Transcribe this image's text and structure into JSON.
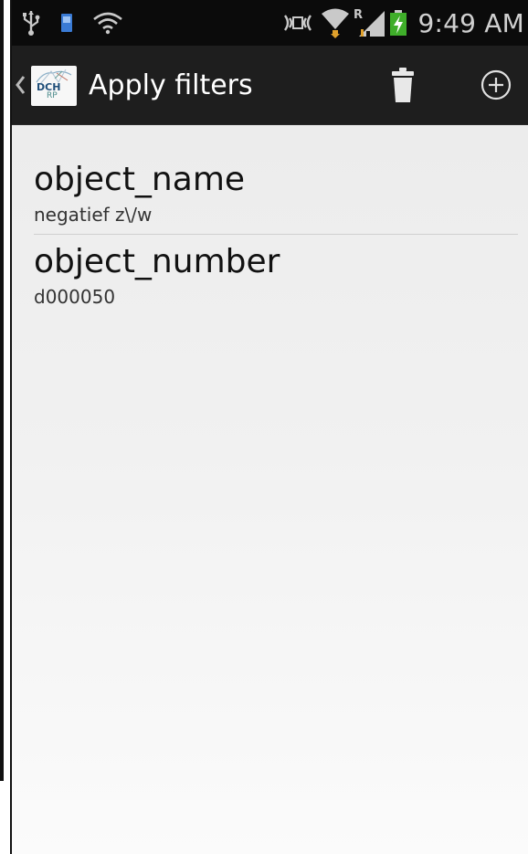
{
  "status_bar": {
    "time": "9:49 AM",
    "icons": [
      "usb-icon",
      "sim-icon",
      "wifi-sync-icon",
      "nfc-icon",
      "wifi-icon",
      "signal-roaming-icon",
      "battery-charging-icon"
    ]
  },
  "action_bar": {
    "title": "Apply filters",
    "logo_text_top": "DCH",
    "logo_text_bottom": "RP",
    "actions": [
      "trash-icon",
      "add-circle-icon"
    ]
  },
  "filters": [
    {
      "name": "object_name",
      "value": "negatief z\\/w"
    },
    {
      "name": "object_number",
      "value": "d000050"
    }
  ],
  "colors": {
    "action_bar_bg": "#1e1e1e",
    "status_bar_bg": "#0b0b0b",
    "content_bg": "#ececec"
  }
}
